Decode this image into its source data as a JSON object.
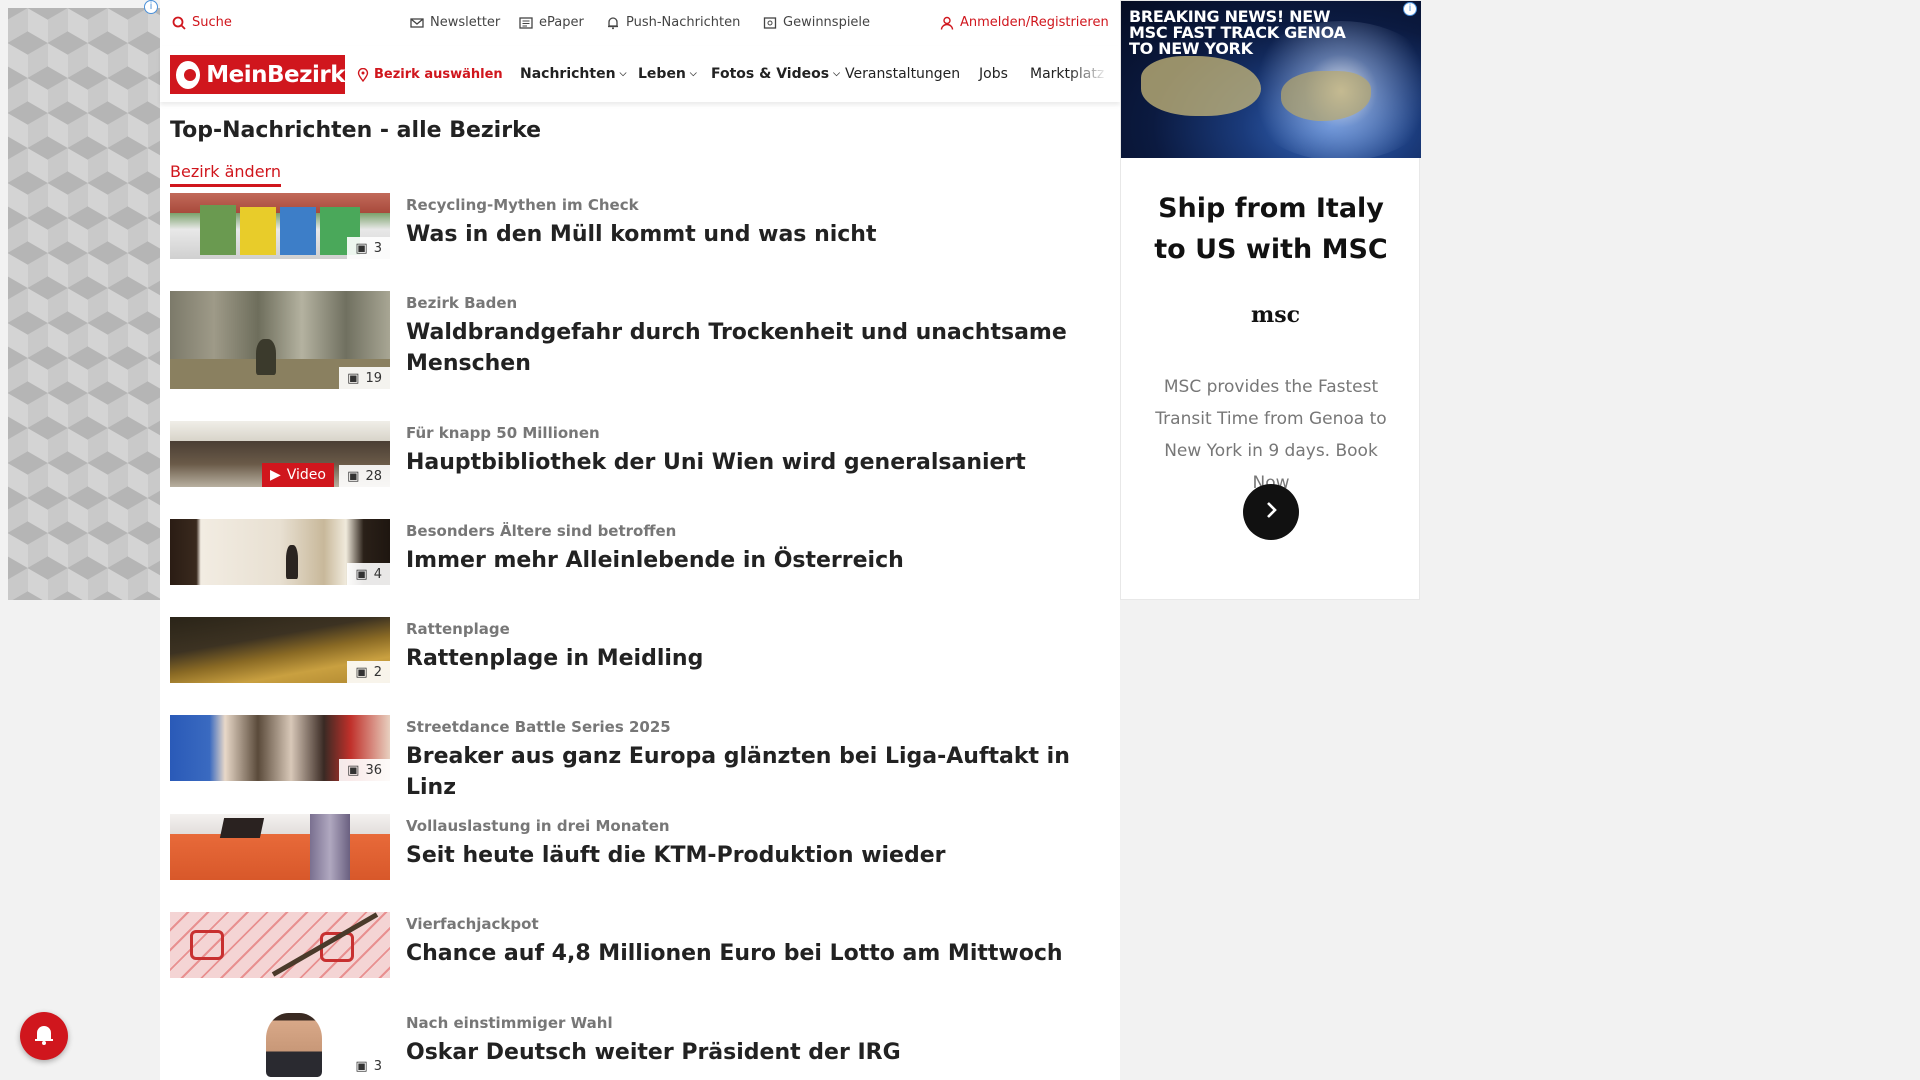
{
  "topbar": {
    "search": "Suche",
    "newsletter": "Newsletter",
    "epaper": "ePaper",
    "push": "Push-Nachrichten",
    "contests": "Gewinnspiele",
    "login": "Anmelden/Registrieren"
  },
  "nav": {
    "logo": "MeinBezirk",
    "select_district": "Bezirk auswählen",
    "items": [
      "Nachrichten",
      "Leben",
      "Fotos & Videos",
      "Veranstaltungen",
      "Jobs",
      "Marktplatz"
    ]
  },
  "page": {
    "title": "Top-Nachrichten - alle Bezirke",
    "change_district": "Bezirk ändern"
  },
  "articles": [
    {
      "kicker": "Recycling-Mythen im Check",
      "headline": "Was in den Müll kommt und was nicht",
      "photos": "3"
    },
    {
      "kicker": "Bezirk Baden",
      "headline": "Waldbrandgefahr durch Trockenheit und unachtsame Menschen",
      "photos": "19"
    },
    {
      "kicker": "Für knapp 50 Millionen",
      "headline": "Hauptbibliothek der Uni Wien wird generalsaniert",
      "photos": "28",
      "video": "Video"
    },
    {
      "kicker": "Besonders Ältere sind betroffen",
      "headline": "Immer mehr Alleinlebende in Österreich",
      "photos": "4"
    },
    {
      "kicker": "Rattenplage",
      "headline": "Rattenplage in Meidling",
      "photos": "2"
    },
    {
      "kicker": "Streetdance Battle Series 2025",
      "headline": "Breaker aus ganz Europa glänzten bei Liga-Auftakt in Linz",
      "photos": "36"
    },
    {
      "kicker": "Vollauslastung in drei Monaten",
      "headline": "Seit heute läuft die KTM-Produktion wieder",
      "photos": ""
    },
    {
      "kicker": "Vierfachjackpot",
      "headline": "Chance auf 4,8 Millionen Euro bei Lotto am Mittwoch",
      "photos": ""
    },
    {
      "kicker": "Nach einstimmiger Wahl",
      "headline": "Oskar Deutsch weiter Präsident der IRG",
      "photos": "3"
    }
  ],
  "ad": {
    "banner_text": "BREAKING NEWS! NEW MSC FAST TRACK GENOA TO NEW YORK",
    "headline": "Ship from Italy to US with MSC",
    "logo": "msc",
    "body": "MSC provides the Fastest Transit Time from Genoa to New York in 9 days. Book Now"
  },
  "colors": {
    "brand": "#d0161d"
  }
}
